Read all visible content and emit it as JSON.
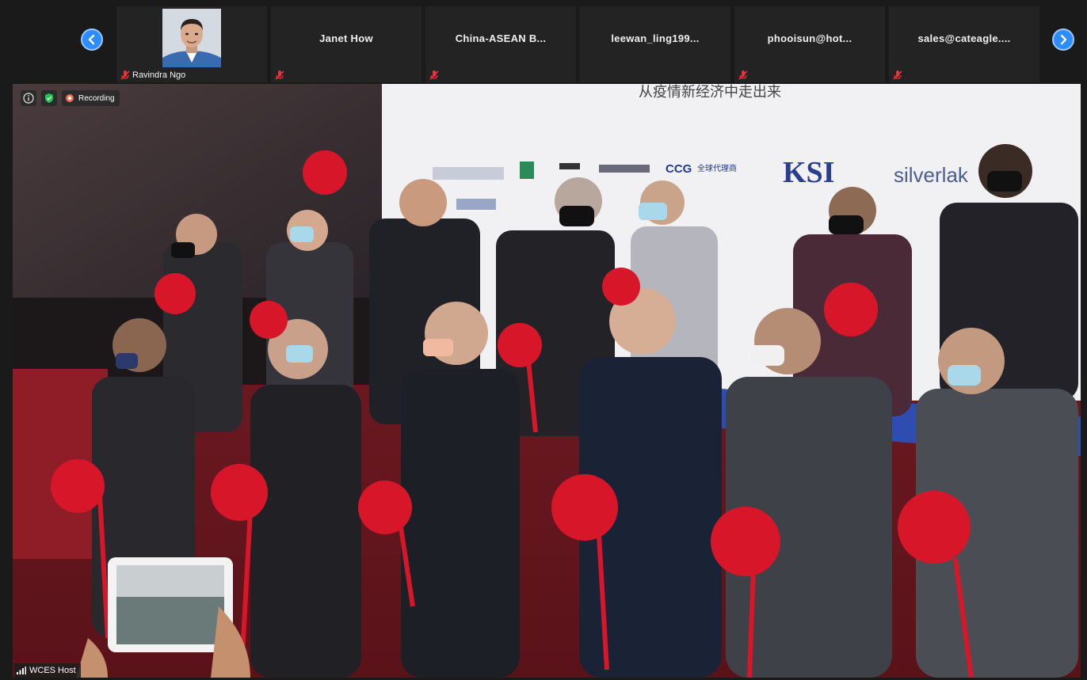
{
  "participants": [
    {
      "name": "",
      "label": "Ravindra Ngo",
      "has_video": true
    },
    {
      "name": "Janet How",
      "label": ""
    },
    {
      "name": "China-ASEAN  B...",
      "label": ""
    },
    {
      "name": "leewan_ling199...",
      "label": ""
    },
    {
      "name": "phooisun@hot...",
      "label": ""
    },
    {
      "name": "sales@cateagle....",
      "label": ""
    }
  ],
  "main_video": {
    "recording_label": "Recording",
    "host_label": "WCES Host",
    "backdrop_logos": {
      "ksi": "KSI",
      "silverlake": "silverlak",
      "ccg": "CCG",
      "ccg_cn": "全球代理商",
      "headline": "从疫情新经济中走出来"
    }
  },
  "colors": {
    "accent_blue": "#2d8cff",
    "mute_red": "#e5363b",
    "ribbon_red": "#d8162a"
  }
}
